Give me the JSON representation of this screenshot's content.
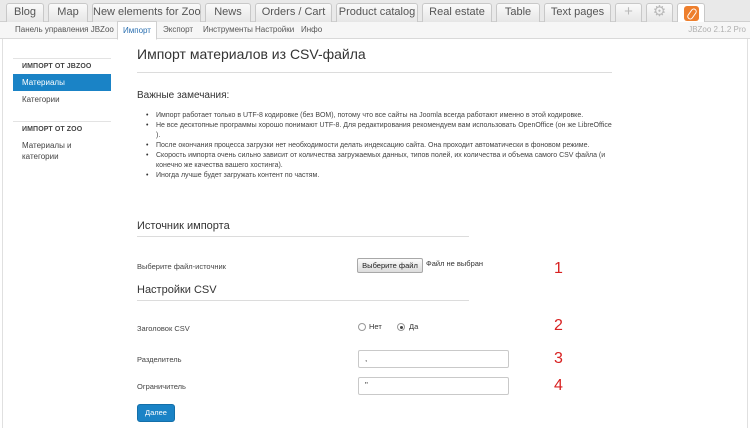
{
  "app_tabs": {
    "blog": "Blog",
    "map": "Map",
    "new_elements": "New elements for Zoo",
    "news": "News",
    "orders": "Orders / Cart",
    "catalog": "Product catalog",
    "real_estate": "Real estate",
    "table": "Table",
    "text_pages": "Text pages",
    "add_icon": "plus-icon",
    "settings_icon": "gear-icon",
    "zoo_icon": "zoo-app-icon"
  },
  "sub_menu": {
    "dashboard": "Панель управления JBZoo",
    "import": "Импорт",
    "export": "Экспорт",
    "tools": "Инструменты",
    "settings": "Настройки",
    "info": "Инфо",
    "version": "JBZoo 2.1.2 Pro"
  },
  "sidebar": {
    "group1_title": "ИМПОРТ ОТ JBZOO",
    "group1_items": [
      "Материалы",
      "Категории"
    ],
    "group2_title": "ИМПОРТ ОТ ZOO",
    "group2_items": [
      "Материалы и категории"
    ]
  },
  "main": {
    "title": "Импорт материалов из CSV-файла",
    "notes_title": "Важные замечания:",
    "notes": [
      "Импорт работает только в UTF-8 кодировке (без BOM), потому что все сайты на Joomla всегда работают именно в этой кодировке.",
      "Не все десктопные программы хорошо понимают UTF-8. Для редактирования рекомендуем вам использовать OpenOffice (он же LibreOffice ).",
      "После окончания процесса загрузки нет необходимости делать индексацию сайта. Она проходит автоматически в фоновом режиме.",
      "Скорость импорта очень сильно зависит от количества загружаемых данных, типов полей, их количества и объема самого CSV файла (и конечно же качества вашего хостинга).",
      "Иногда лучше будет загружать контент по частям."
    ],
    "source_section": "Источник импорта",
    "file_label": "Выберите файл-источник",
    "file_button": "Выберите файл",
    "file_status": "Файл не выбран",
    "csv_section": "Настройки CSV",
    "header_label": "Заголовок CSV",
    "header_options": [
      "Нет",
      "Да"
    ],
    "header_selected": "Да",
    "delimiter_label": "Разделитель",
    "delimiter_value": ",",
    "enclosure_label": "Ограничитель",
    "enclosure_value": "\"",
    "next_button": "Далее"
  },
  "annotations": [
    "1",
    "2",
    "3",
    "4"
  ],
  "colors": {
    "accent": "#1a83c6",
    "annotation": "#d82121"
  }
}
